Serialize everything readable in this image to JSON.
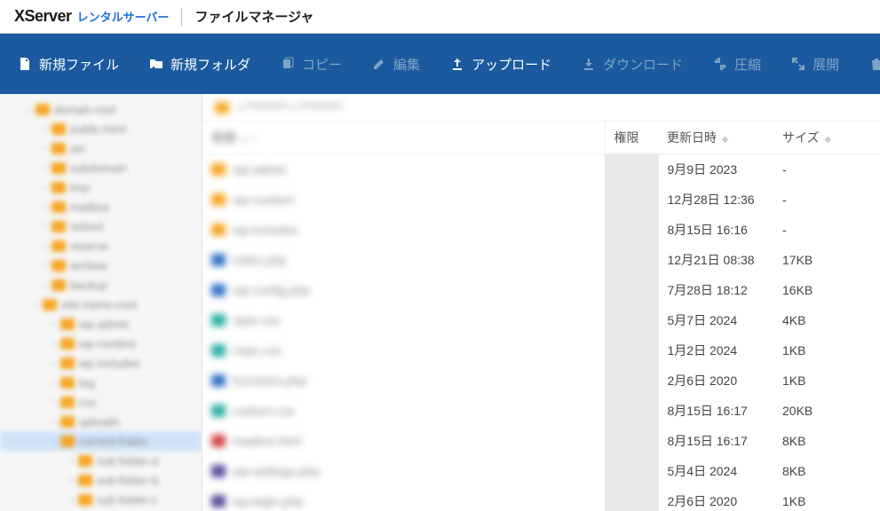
{
  "header": {
    "logo_main": "XServer",
    "logo_sub": "レンタルサーバー",
    "title": "ファイルマネージャ"
  },
  "toolbar": {
    "new_file": "新規ファイル",
    "new_folder": "新規フォルダ",
    "copy": "コピー",
    "edit": "編集",
    "upload": "アップロード",
    "download": "ダウンロード",
    "compress": "圧縮",
    "extract": "展開",
    "delete": "削除"
  },
  "breadcrumb": {
    "text": "/ ********* / *********"
  },
  "columns": {
    "name": "名前",
    "perm": "権限",
    "date": "更新日時",
    "size": "サイズ"
  },
  "tree": [
    {
      "indent": 28,
      "label": "domain-root"
    },
    {
      "indent": 46,
      "label": "public-html"
    },
    {
      "indent": 46,
      "label": "etc"
    },
    {
      "indent": 46,
      "label": "subdomain"
    },
    {
      "indent": 46,
      "label": "tmp"
    },
    {
      "indent": 46,
      "label": "mailbox"
    },
    {
      "indent": 46,
      "label": "retired"
    },
    {
      "indent": 46,
      "label": "reserve"
    },
    {
      "indent": 46,
      "label": "archive"
    },
    {
      "indent": 46,
      "label": "backup"
    },
    {
      "indent": 36,
      "label": "site-name-com"
    },
    {
      "indent": 56,
      "label": "wp-admin"
    },
    {
      "indent": 56,
      "label": "wp-content"
    },
    {
      "indent": 56,
      "label": "wp-includes"
    },
    {
      "indent": 56,
      "label": "log"
    },
    {
      "indent": 56,
      "label": "css"
    },
    {
      "indent": 56,
      "label": "uploads"
    },
    {
      "indent": 56,
      "label": "current-folder",
      "selected": true
    },
    {
      "indent": 76,
      "label": "sub-folder-a"
    },
    {
      "indent": 76,
      "label": "sub-folder-b"
    },
    {
      "indent": 76,
      "label": "sub-folder-c"
    }
  ],
  "files": [
    {
      "icon": "ic-folder",
      "name": "wp-admin",
      "perm": "",
      "date": "9月9日 2023",
      "size": "-"
    },
    {
      "icon": "ic-folder",
      "name": "wp-content",
      "perm": "",
      "date": "12月28日 12:36",
      "size": "-"
    },
    {
      "icon": "ic-folder",
      "name": "wp-includes",
      "perm": "",
      "date": "8月15日 16:16",
      "size": "-"
    },
    {
      "icon": "ic-blue",
      "name": "index.php",
      "perm": "",
      "date": "12月21日 08:38",
      "size": "17KB"
    },
    {
      "icon": "ic-blue",
      "name": "wp-config.php",
      "perm": "",
      "date": "7月28日 18:12",
      "size": "16KB"
    },
    {
      "icon": "ic-teal",
      "name": "style.css",
      "perm": "",
      "date": "5月7日 2024",
      "size": "4KB"
    },
    {
      "icon": "ic-teal",
      "name": "main.css",
      "perm": "",
      "date": "1月2日 2024",
      "size": "1KB"
    },
    {
      "icon": "ic-blue",
      "name": "functions.php",
      "perm": "",
      "date": "2月6日 2020",
      "size": "1KB"
    },
    {
      "icon": "ic-teal",
      "name": "custom.css",
      "perm": "",
      "date": "8月15日 16:17",
      "size": "20KB"
    },
    {
      "icon": "ic-red",
      "name": "readme.html",
      "perm": "",
      "date": "8月15日 16:17",
      "size": "8KB"
    },
    {
      "icon": "ic-purple",
      "name": "wp-settings.php",
      "perm": "",
      "date": "5月4日 2024",
      "size": "8KB"
    },
    {
      "icon": "ic-purple",
      "name": "wp-login.php",
      "perm": "",
      "date": "2月6日 2020",
      "size": "1KB"
    }
  ]
}
